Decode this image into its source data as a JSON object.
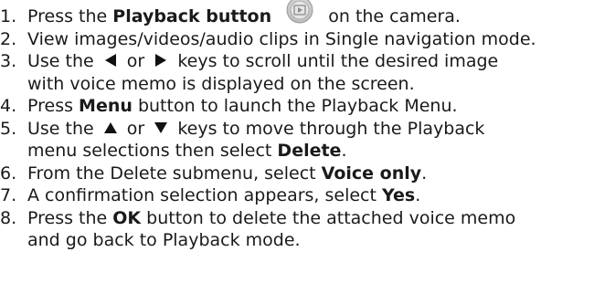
{
  "steps": [
    {
      "num": "1.",
      "a": "Press the ",
      "b_bold": "Playback button",
      "c": " on the camera."
    },
    {
      "num": "2.",
      "text": "View images/videos/audio clips in Single navigation mode."
    },
    {
      "num": "3.",
      "a": "Use the ",
      "b": " or ",
      "c": " keys to scroll until the desired image",
      "cont": "with voice memo is displayed on the screen."
    },
    {
      "num": "4.",
      "a": "Press ",
      "bold": "Menu",
      "b": " button to launch the Playback Menu."
    },
    {
      "num": "5.",
      "a": "Use the ",
      "b": " or ",
      "c": " keys to move through the Playback",
      "cont_a": "menu selections then select ",
      "cont_bold": "Delete",
      "cont_b": "."
    },
    {
      "num": "6.",
      "a": "From the Delete submenu, select ",
      "bold": "Voice only",
      "b": "."
    },
    {
      "num": "7.",
      "a": "A confirmation selection appears, select ",
      "bold": "Yes",
      "b": "."
    },
    {
      "num": "8.",
      "a": "Press the ",
      "bold": "OK",
      "b": " button to delete the attached voice memo",
      "cont": "and go back to Playback mode."
    }
  ],
  "icons": {
    "playback": "playback-button-icon",
    "left": "left-arrow-key-icon",
    "right": "right-arrow-key-icon",
    "up": "up-arrow-key-icon",
    "down": "down-arrow-key-icon"
  }
}
